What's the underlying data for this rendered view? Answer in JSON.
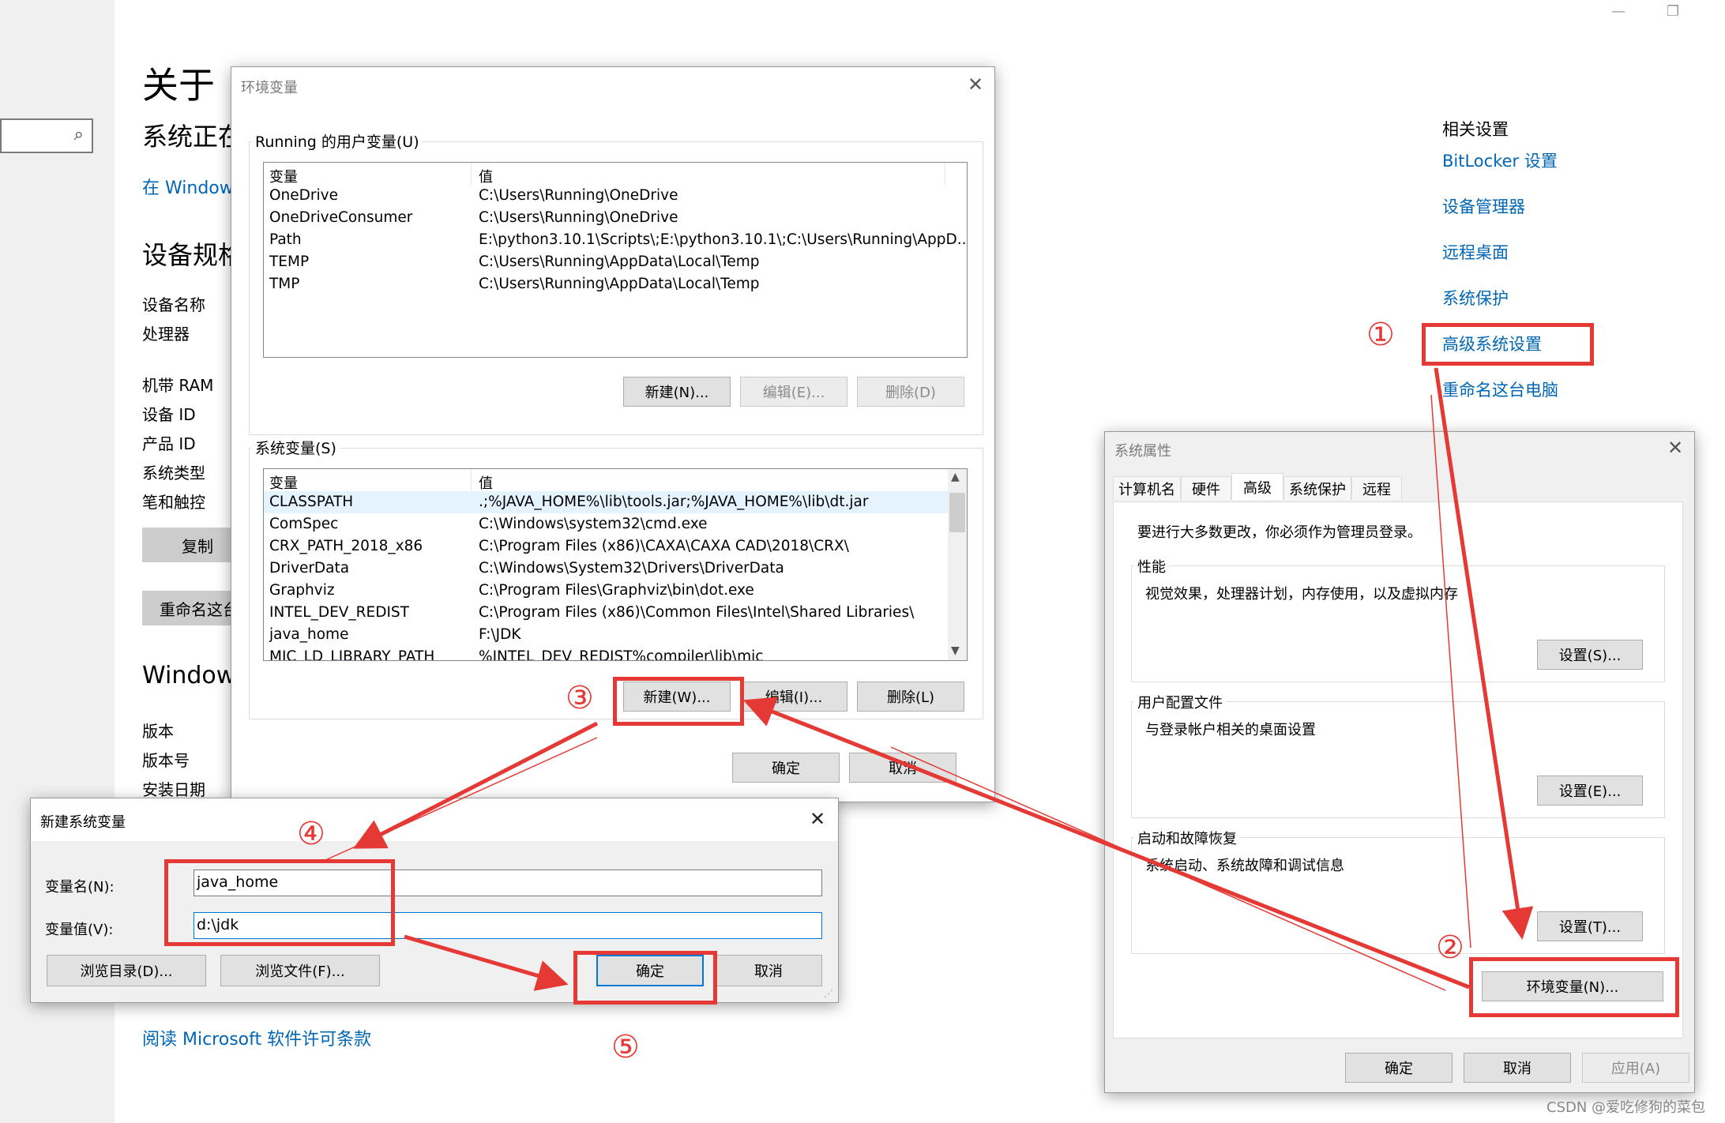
{
  "settings": {
    "title": "关于",
    "status_heading": "系统正在",
    "windows_link": "在 Windows",
    "device_specs_heading": "设备规格",
    "spec_labels": [
      "设备名称",
      "处理器",
      "机带 RAM",
      "设备 ID",
      "产品 ID",
      "系统类型",
      "笔和触控"
    ],
    "copy_button": "复制",
    "rename_button": "重命名这台",
    "windows_heading": "Windows",
    "windows_labels": [
      "版本",
      "版本号",
      "安装日期"
    ],
    "license_link": "阅读 Microsoft 软件许可条款",
    "related_heading": "相关设置",
    "related_links": [
      "BitLocker 设置",
      "设备管理器",
      "远程桌面",
      "系统保护",
      "高级系统设置",
      "重命名这台电脑"
    ]
  },
  "window_controls": {
    "minimize": "—",
    "restore": "❐"
  },
  "env_dialog": {
    "title": "环境变量",
    "user_group_label": "Running 的用户变量(U)",
    "columns": [
      "变量",
      "值"
    ],
    "user_vars": [
      {
        "name": "OneDrive",
        "value": "C:\\Users\\Running\\OneDrive"
      },
      {
        "name": "OneDriveConsumer",
        "value": "C:\\Users\\Running\\OneDrive"
      },
      {
        "name": "Path",
        "value": "E:\\python3.10.1\\Scripts\\;E:\\python3.10.1\\;C:\\Users\\Running\\AppD..."
      },
      {
        "name": "TEMP",
        "value": "C:\\Users\\Running\\AppData\\Local\\Temp"
      },
      {
        "name": "TMP",
        "value": "C:\\Users\\Running\\AppData\\Local\\Temp"
      }
    ],
    "user_buttons": {
      "new": "新建(N)...",
      "edit": "编辑(E)...",
      "delete": "删除(D)"
    },
    "system_group_label": "系统变量(S)",
    "system_vars": [
      {
        "name": "CLASSPATH",
        "value": ".;%JAVA_HOME%\\lib\\tools.jar;%JAVA_HOME%\\lib\\dt.jar"
      },
      {
        "name": "ComSpec",
        "value": "C:\\Windows\\system32\\cmd.exe"
      },
      {
        "name": "CRX_PATH_2018_x86",
        "value": "C:\\Program Files (x86)\\CAXA\\CAXA CAD\\2018\\CRX\\"
      },
      {
        "name": "DriverData",
        "value": "C:\\Windows\\System32\\Drivers\\DriverData"
      },
      {
        "name": "Graphviz",
        "value": "C:\\Program Files\\Graphviz\\bin\\dot.exe"
      },
      {
        "name": "INTEL_DEV_REDIST",
        "value": "C:\\Program Files (x86)\\Common Files\\Intel\\Shared Libraries\\"
      },
      {
        "name": "java_home",
        "value": "F:\\JDK"
      },
      {
        "name": "MIC_LD_LIBRARY_PATH",
        "value": "%INTEL_DEV_REDIST%compiler\\lib\\mic"
      }
    ],
    "system_buttons": {
      "new": "新建(W)...",
      "edit": "编辑(I)...",
      "delete": "删除(L)"
    },
    "ok": "确定",
    "cancel": "取消"
  },
  "sysprop_dialog": {
    "title": "系统属性",
    "tabs": [
      "计算机名",
      "硬件",
      "高级",
      "系统保护",
      "远程"
    ],
    "admin_note": "要进行大多数更改，你必须作为管理员登录。",
    "perf_label": "性能",
    "perf_desc": "视觉效果，处理器计划，内存使用，以及虚拟内存",
    "perf_button": "设置(S)...",
    "profile_label": "用户配置文件",
    "profile_desc": "与登录帐户相关的桌面设置",
    "profile_button": "设置(E)...",
    "startup_label": "启动和故障恢复",
    "startup_desc": "系统启动、系统故障和调试信息",
    "startup_button": "设置(T)...",
    "env_button": "环境变量(N)...",
    "ok": "确定",
    "cancel": "取消",
    "apply": "应用(A)"
  },
  "new_var_dialog": {
    "title": "新建系统变量",
    "name_label": "变量名(N):",
    "name_value": "java_home",
    "value_label": "变量值(V):",
    "value_value": "d:\\jdk",
    "browse_dir": "浏览目录(D)...",
    "browse_file": "浏览文件(F)...",
    "ok": "确定",
    "cancel": "取消"
  },
  "annotations": {
    "steps": [
      "①",
      "②",
      "③",
      "④",
      "⑤"
    ],
    "color": "#e53935"
  },
  "watermark": "CSDN @爱吃修狗的菜包"
}
